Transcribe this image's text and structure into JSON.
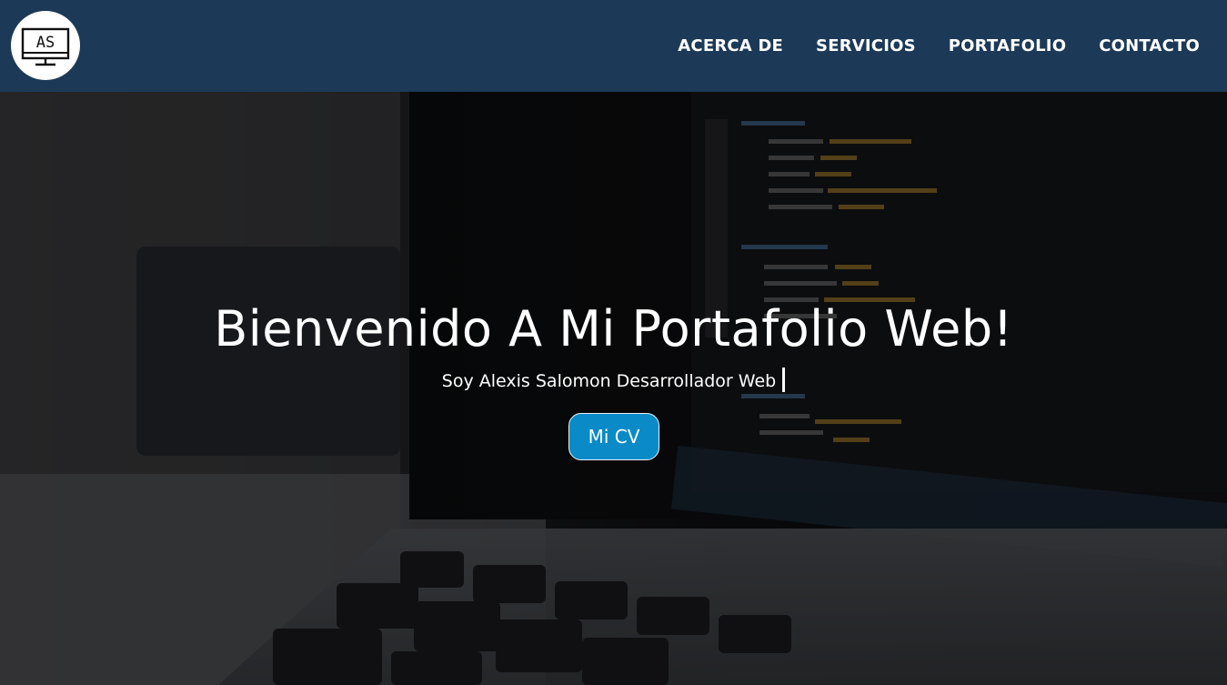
{
  "header": {
    "logo_text": "AS",
    "nav": [
      {
        "label": "ACERCA DE"
      },
      {
        "label": "SERVICIOS"
      },
      {
        "label": "PORTAFOLIO"
      },
      {
        "label": "CONTACTO"
      }
    ]
  },
  "hero": {
    "title": "Bienvenido A Mi Portafolio Web!",
    "subtitle": "Soy Alexis Salomon Desarrollador Web",
    "cv_button": "Mi CV"
  },
  "colors": {
    "header_bg": "#1c3a57",
    "button_bg": "#0a8ac7",
    "text": "#ffffff"
  },
  "icons": {
    "logo": "monitor-icon"
  }
}
